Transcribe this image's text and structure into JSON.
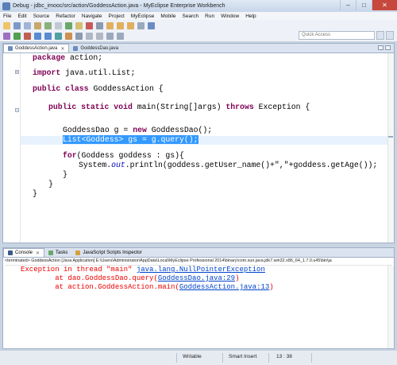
{
  "window": {
    "title": "Debug - jdbc_imooc/src/action/GoddessAction.java - MyEclipse Enterprise Workbench",
    "controls": {
      "minimize": "–",
      "maximize": "□",
      "close": "✕"
    }
  },
  "menu": [
    "File",
    "Edit",
    "Source",
    "Refactor",
    "Navigate",
    "Project",
    "MyEclipse",
    "Mobile",
    "Search",
    "Run",
    "Window",
    "Help"
  ],
  "toolbar": {
    "quick_access_placeholder": "Quick Access"
  },
  "editor": {
    "tabs": [
      {
        "label": "GoddessAction.java",
        "active": true
      },
      {
        "label": "GoddessDao.java",
        "active": false
      }
    ],
    "code": {
      "l1": {
        "kw": "package",
        "rest": " action;"
      },
      "l2": {
        "kw": "import",
        "rest": " java.util.List;"
      },
      "l3": {
        "kw": "public class",
        "rest": " GoddessAction {"
      },
      "l4": {
        "kw1": "public static void",
        "mid": " main(String[]args) ",
        "kw2": "throws",
        "rest": " Exception {"
      },
      "l5": {
        "pre": "GoddessDao g = ",
        "kw": "new",
        "rest": " GoddessDao();"
      },
      "l6": {
        "selected": "List<Goddess> gs = g.query();"
      },
      "l7": {
        "kw": "for",
        "rest": "(Goddess goddess : gs){"
      },
      "l8": {
        "pre": "System.",
        "it": "out",
        "rest": ".println(goddess.getUser_name()+\",\"+goddess.getAge());"
      },
      "l9": "}",
      "l10": "}",
      "l11": "}"
    }
  },
  "console": {
    "tabs": [
      {
        "label": "Console",
        "close": "✕"
      },
      {
        "label": "Tasks"
      },
      {
        "label": "JavaScript Scripts Inspector"
      }
    ],
    "info": "<terminated> GoddessAction [Java Application] E:\\Users\\Administrator\\AppData\\Local\\MyEclipse Professional 2014\\binary\\com.sun.java.jdk7.win32.x86_64_1.7.0.u45\\bin\\ja",
    "lines": {
      "l1": {
        "text": "Exception in thread \"main\" ",
        "link": "java.lang.NullPointerException"
      },
      "l2": {
        "text": "\tat dao.GoddessDao.query(",
        "link": "GoddessDao.java:29",
        "end": ")"
      },
      "l3": {
        "text": "\tat action.GoddessAction.main(",
        "link": "GoddessAction.java:13",
        "end": ")"
      }
    }
  },
  "status": {
    "writable": "Writable",
    "insert_mode": "Smart Insert",
    "position": "13 : 38"
  }
}
